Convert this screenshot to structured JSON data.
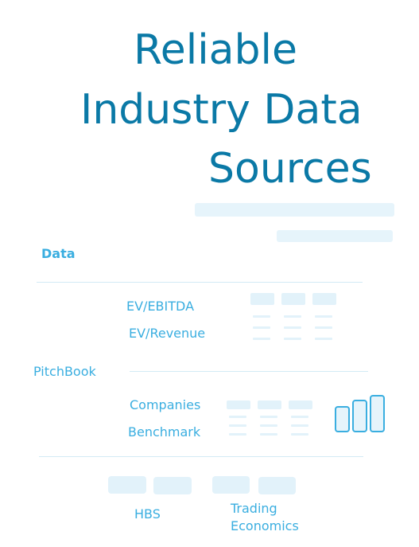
{
  "title": {
    "line1": "Reliable",
    "line2": "Industry Data",
    "line3": "Sources"
  },
  "section": {
    "heading": "Data"
  },
  "group_a": {
    "item1": "EV/EBITDA",
    "item2": "EV/Revenue"
  },
  "provider": {
    "name": "PitchBook"
  },
  "group_b": {
    "item1": "Companies",
    "item2": "Benchmark"
  },
  "footer": {
    "source1": "HBS",
    "source2_line1": "Trading",
    "source2_line2": "Economics"
  },
  "icons": {
    "chart": "bar-chart-icon"
  },
  "colors": {
    "title": "#0a79a6",
    "label": "#3aaee0",
    "placeholder": "#e2f2fa"
  }
}
